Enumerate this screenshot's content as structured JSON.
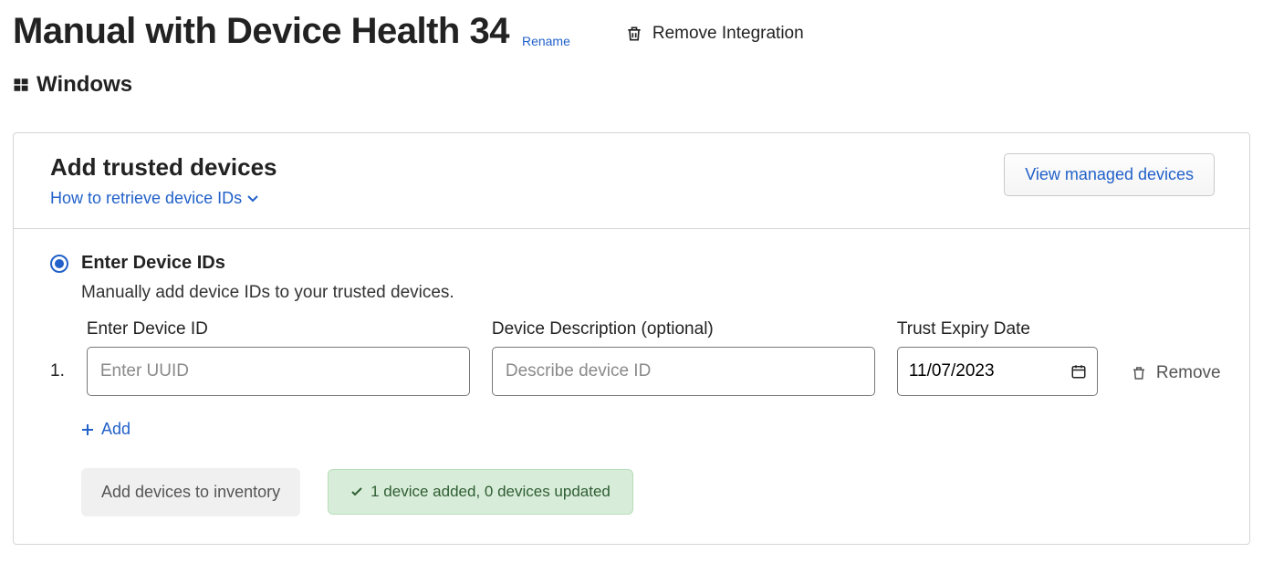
{
  "header": {
    "title": "Manual with Device Health 34",
    "rename_label": "Rename",
    "remove_label": "Remove Integration"
  },
  "platform": {
    "name": "Windows"
  },
  "panel": {
    "title": "Add trusted devices",
    "howto_link": "How to retrieve device IDs",
    "view_managed_label": "View managed devices"
  },
  "option": {
    "title": "Enter Device IDs",
    "description": "Manually add device IDs to your trusted devices."
  },
  "labels": {
    "device_id": "Enter Device ID",
    "device_desc": "Device Description (optional)",
    "expiry": "Trust Expiry Date"
  },
  "row": {
    "number": "1.",
    "uuid_placeholder": "Enter UUID",
    "uuid_value": "",
    "desc_placeholder": "Describe device ID",
    "desc_value": "",
    "expiry_value": "11/07/2023",
    "remove_label": "Remove"
  },
  "actions": {
    "add_label": "Add",
    "submit_label": "Add devices to inventory"
  },
  "status": {
    "message": "1 device added, 0 devices updated"
  }
}
